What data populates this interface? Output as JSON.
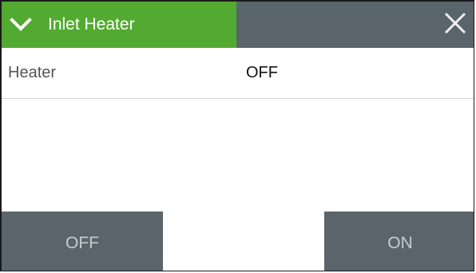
{
  "panel": {
    "title": "Inlet Heater",
    "accent_color": "#52ab30",
    "header_color": "#5a656b",
    "icons": {
      "collapse": "chevron-down-icon",
      "close": "close-icon"
    }
  },
  "rows": [
    {
      "label": "Heater",
      "value": "OFF"
    }
  ],
  "actions": {
    "off_label": "OFF",
    "on_label": "ON"
  }
}
